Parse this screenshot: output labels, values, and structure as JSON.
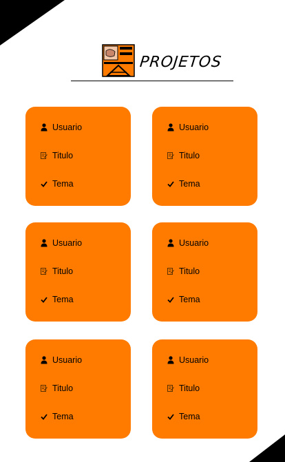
{
  "header": {
    "title": "PROJETOS"
  },
  "cards": [
    {
      "user_label": "Usuario",
      "title_label": "Titulo",
      "topic_label": "Tema"
    },
    {
      "user_label": "Usuario",
      "title_label": "Titulo",
      "topic_label": "Tema"
    },
    {
      "user_label": "Usuario",
      "title_label": "Titulo",
      "topic_label": "Tema"
    },
    {
      "user_label": "Usuario",
      "title_label": "Titulo",
      "topic_label": "Tema"
    },
    {
      "user_label": "Usuario",
      "title_label": "Titulo",
      "topic_label": "Tema"
    },
    {
      "user_label": "Usuario",
      "title_label": "Titulo",
      "topic_label": "Tema"
    }
  ],
  "icons": {
    "user": "person-icon",
    "title": "edit-note-icon",
    "topic": "check-icon"
  },
  "colors": {
    "card": "#ff7b00",
    "background": "#ffffff",
    "accent": "#000000"
  }
}
